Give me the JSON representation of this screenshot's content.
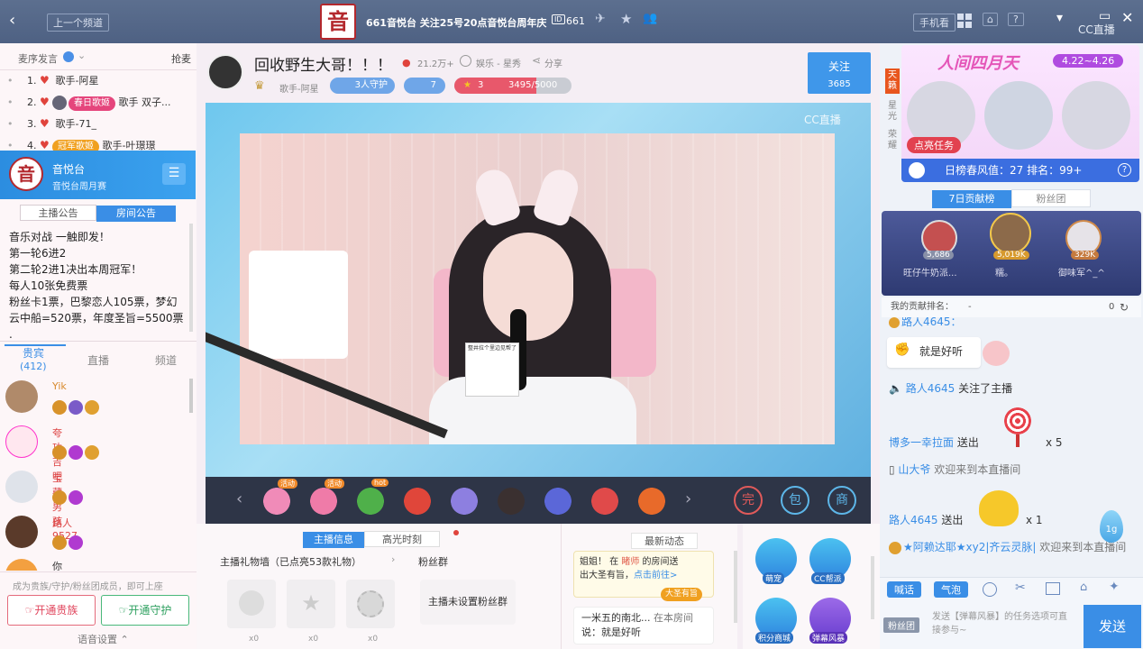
{
  "topbar": {
    "prev_channel": "上一个频道",
    "channel_title": "661音悦台 关注25号20点音悦台周年庆",
    "room_id": "661",
    "phone_view": "手机看",
    "cc_logo": "CC直播",
    "logo_glyph": "音"
  },
  "left": {
    "tabs": {
      "seat": "麦序发言",
      "grab": "抢麦"
    },
    "mic_list": [
      {
        "num": "1.",
        "name": "歌手-阿星",
        "tag": ""
      },
      {
        "num": "2.",
        "name": "歌手 双子...",
        "tag": "春日歌姬"
      },
      {
        "num": "3.",
        "name": "歌手-71_",
        "tag": ""
      },
      {
        "num": "4.",
        "name": "歌手-叶璟璟",
        "tag": "冠军歌姬"
      }
    ],
    "channel": {
      "name": "音悦台",
      "sub": "音悦台周月赛",
      "logo_glyph": "音"
    },
    "notice_tabs": [
      "主播公告",
      "房间公告"
    ],
    "notice_lines": [
      "音乐对战 一触即发！",
      "第一轮6进2",
      "第二轮2进1决出本周冠军！",
      "每人10张免费票",
      "粉丝卡1票，巴黎恋人105票，梦幻",
      "云中船=520票，年度圣旨=5500票",
      "."
    ],
    "audience_tabs": {
      "vip": "贵宾",
      "vip_count": "(412)",
      "live": "直播",
      "channel": "频道"
    },
    "audience": [
      {
        "name": "Yik",
        "color": "#d88b2f"
      },
      {
        "name": "夸功吉吧",
        "color": "#d44"
      },
      {
        "name": "宝藏男孩",
        "color": "#d44"
      },
      {
        "name": "路人9527",
        "color": "#d44"
      },
      {
        "name": "你就是那束阳光",
        "color": "#333"
      }
    ],
    "hint": "成为贵族/守护/粉丝团成员，即可上座",
    "btn_noble": "开通贵族",
    "btn_guard": "开通守护",
    "voice_settings": "语音设置"
  },
  "anchor": {
    "title": "回收野生大哥！！！",
    "hot": "21.2万+",
    "category": "娱乐 - 星秀",
    "share": "分享",
    "singer": "歌手-阿星",
    "guards": "3人守护",
    "fans": "7",
    "level": "3",
    "exp": "3495/5000",
    "exp_pct": 0.699,
    "follow": "关注",
    "follow_count": "3685",
    "watermark": "CC直播",
    "mic_sign": "整井拉个里边见帮了"
  },
  "gift_bar": {
    "badges": [
      "活动",
      "活动",
      "hot",
      "",
      "",
      "",
      "",
      "",
      ""
    ],
    "actions": [
      "完",
      "包",
      "商"
    ]
  },
  "bottom": {
    "tabs": [
      "主播信息",
      "高光时刻"
    ],
    "wall": "主播礼物墙（已点亮53款礼物）",
    "fans_group": "粉丝群",
    "wall_counts": [
      "x0",
      "x0",
      "x0"
    ],
    "no_fans_group": "主播未设置粉丝群",
    "news_title": "最新动态",
    "news1": [
      "姐姐！ 在 ",
      "睹师",
      " 的房间送",
      "出大圣有旨，",
      "点击前往>"
    ],
    "news1_tag": "大圣有旨",
    "news2": [
      "一米五的南北...",
      "在本房间",
      "说：就是好听"
    ],
    "apps": [
      "萌宠",
      "CC帮派",
      "积分商城",
      "弹幕风暴"
    ]
  },
  "right": {
    "side_tabs": [
      "天籁",
      "星光",
      "荣耀"
    ],
    "event_title": "人间四月天",
    "event_dates": "4.22~4.26",
    "event_task": "点亮任务",
    "event_status": "日榜春风值：27  排名：99+",
    "rank_tabs": [
      "7日贡献榜",
      "粉丝团"
    ],
    "top3": [
      {
        "name": "旺仔牛奶派...",
        "value": "5,686"
      },
      {
        "name": "糯。",
        "value": "5,019K"
      },
      {
        "name": "御味军^_^",
        "value": "329K"
      }
    ],
    "my_rank_label": "我的贡献排名：",
    "my_rank": "-",
    "my_score": "0",
    "chat": [
      {
        "type": "partial",
        "text": "路人4645："
      },
      {
        "type": "bubble",
        "text": "就是好听"
      },
      {
        "type": "follow",
        "user": "路人4645",
        "text": "关注了主播"
      },
      {
        "type": "gift",
        "user": "博多一幸拉面",
        "verb": "送出",
        "count": "x 5"
      },
      {
        "type": "enter",
        "user": "山大爷",
        "text": "欢迎来到本直播间"
      },
      {
        "type": "gift2",
        "user": "路人4645",
        "verb": "送出",
        "count": "x 1"
      },
      {
        "type": "welcome",
        "user": "★阿赖达耶★xy2|齐云灵脉|",
        "text": "欢迎来到本直播间"
      }
    ],
    "tool": [
      "喊话",
      "气泡"
    ],
    "fans_btn": "粉丝团",
    "input_placeholder": "发送【弹幕风暴】的任务选项可直接参与~",
    "send": "发送",
    "level_badge": "1g"
  }
}
